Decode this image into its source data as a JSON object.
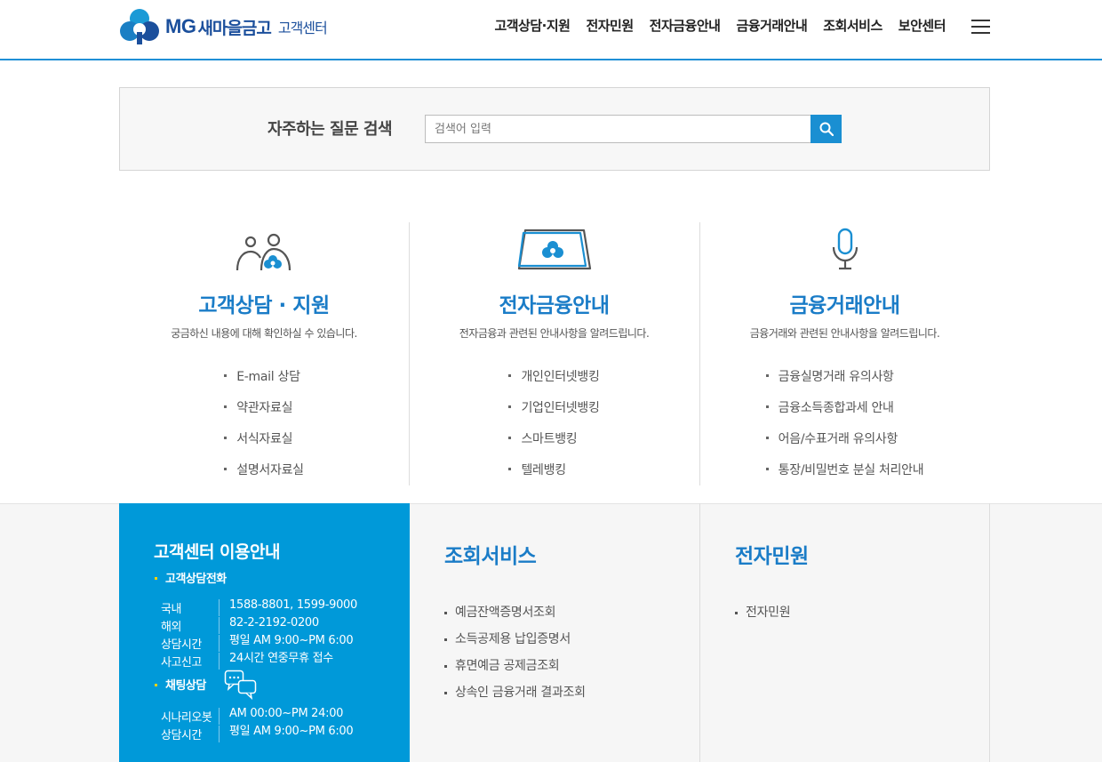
{
  "header": {
    "logo_mg": "MG",
    "logo_brand": "새마을금고",
    "logo_sub": "고객센터",
    "nav": [
      "고객상담·지원",
      "전자민원",
      "전자금융안내",
      "금융거래안내",
      "조회서비스",
      "보안센터"
    ],
    "menu_icon": "hamburger-icon"
  },
  "search": {
    "title": "자주하는 질문 검색",
    "placeholder": "검색어 입력",
    "button_icon": "search-icon"
  },
  "columns": [
    {
      "icon": "people-cloud-icon",
      "title": "고객상담 · 지원",
      "desc": "궁금하신 내용에 대해 확인하실 수 있습니다.",
      "items": [
        "E-mail 상담",
        "약관자료실",
        "서식자료실",
        "설명서자료실"
      ]
    },
    {
      "icon": "cloud-card-icon",
      "title": "전자금융안내",
      "desc": "전자금융과 관련된 안내사항을 알려드립니다.",
      "items": [
        "개인인터넷뱅킹",
        "기업인터넷뱅킹",
        "스마트뱅킹",
        "텔레뱅킹"
      ]
    },
    {
      "icon": "microphone-icon",
      "title": "금융거래안내",
      "desc": "금융거래와 관련된 안내사항을 알려드립니다.",
      "items": [
        "금융실명거래 유의사항",
        "금융소득종합과세 안내",
        "어음/수표거래 유의사항",
        "통장/비밀번호 분실 처리안내"
      ]
    }
  ],
  "info": {
    "title": "고객센터 이용안내",
    "phone_section": "고객상담전화",
    "phone_rows": [
      {
        "k": "국내",
        "v": "1588-8801, 1599-9000"
      },
      {
        "k": "해외",
        "v": "82-2-2192-0200"
      },
      {
        "k": "상담시간",
        "v": "평일 AM 9:00~PM 6:00"
      },
      {
        "k": "사고신고",
        "v": "24시간 연중무휴 접수"
      }
    ],
    "chat_section": "채팅상담",
    "chat_icon": "chat-bubbles-icon",
    "chat_rows": [
      {
        "k": "시나리오봇",
        "v": "AM 00:00~PM 24:00"
      },
      {
        "k": "상담시간",
        "v": "평일 AM 9:00~PM 6:00"
      }
    ]
  },
  "inquiry": {
    "title": "조회서비스",
    "items": [
      "예금잔액증명서조회",
      "소득공제용 납입증명서",
      "휴면예금 공제금조회",
      "상속인 금융거래 결과조회"
    ]
  },
  "complaint": {
    "title": "전자민원",
    "items": [
      "전자민원"
    ]
  },
  "colors": {
    "primary": "#1a7cc7",
    "info_bg": "#0099d9",
    "header_line": "#1f8fd6",
    "logo": "#1b4f9c"
  }
}
